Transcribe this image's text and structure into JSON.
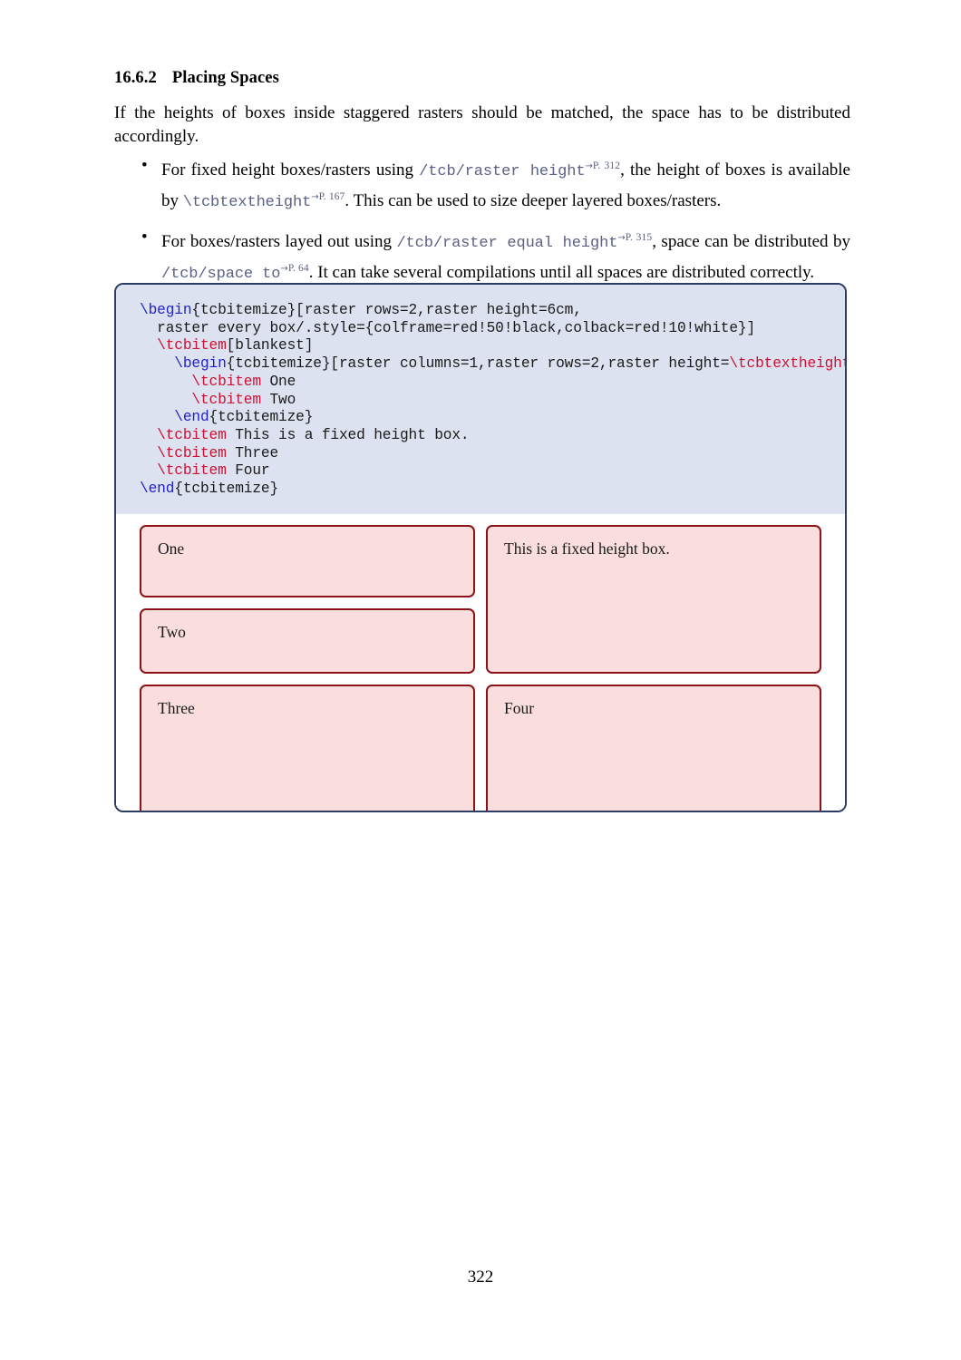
{
  "heading": {
    "number": "16.6.2",
    "title": "Placing Spaces"
  },
  "intro": {
    "text": "If the heights of boxes inside staggered rasters should be matched, the space has to be distributed accordingly."
  },
  "bullets": [
    {
      "marker": "•",
      "part1": "For fixed height boxes/rasters using ",
      "code1": "/tcb/raster height",
      "ref1_arrow": "→",
      "ref1": "P. 312",
      "part2": ", the height of boxes is available by ",
      "code2": "\\tcbtextheight",
      "ref2_arrow": "→",
      "ref2": "P. 167",
      "part3": ". This can be used to size deeper layered boxes/rasters."
    },
    {
      "marker": "•",
      "part1": "For boxes/rasters layed out using ",
      "code1": "/tcb/raster equal height",
      "ref1_arrow": "→",
      "ref1": "P. 315",
      "part2": ", space can be distributed by ",
      "code2": "/tcb/space to",
      "ref2_arrow": "→",
      "ref2": "P. 64",
      "part3": ". It can take several compilations until all spaces are distributed correctly."
    }
  ],
  "code": {
    "lines": [
      [
        {
          "t": "\\begin",
          "c": "blue"
        },
        {
          "t": "{tcbitemize}[raster rows=2,raster height=6cm,",
          "c": "plain"
        }
      ],
      [
        {
          "t": "  raster every box/.style={colframe=red!50!black,colback=red!10!white}]",
          "c": "plain"
        }
      ],
      [
        {
          "t": "  ",
          "c": "plain"
        },
        {
          "t": "\\tcbitem",
          "c": "red"
        },
        {
          "t": "[blankest]",
          "c": "plain"
        }
      ],
      [
        {
          "t": "    ",
          "c": "plain"
        },
        {
          "t": "\\begin",
          "c": "blue"
        },
        {
          "t": "{tcbitemize}[raster columns=1,raster rows=2,raster height=",
          "c": "plain"
        },
        {
          "t": "\\tcbtextheight",
          "c": "red"
        },
        {
          "t": "]",
          "c": "plain"
        }
      ],
      [
        {
          "t": "      ",
          "c": "plain"
        },
        {
          "t": "\\tcbitem",
          "c": "red"
        },
        {
          "t": " One",
          "c": "plain"
        }
      ],
      [
        {
          "t": "      ",
          "c": "plain"
        },
        {
          "t": "\\tcbitem",
          "c": "red"
        },
        {
          "t": " Two",
          "c": "plain"
        }
      ],
      [
        {
          "t": "    ",
          "c": "plain"
        },
        {
          "t": "\\end",
          "c": "blue"
        },
        {
          "t": "{tcbitemize}",
          "c": "plain"
        }
      ],
      [
        {
          "t": "  ",
          "c": "plain"
        },
        {
          "t": "\\tcbitem",
          "c": "red"
        },
        {
          "t": " This is a fixed height box.",
          "c": "plain"
        }
      ],
      [
        {
          "t": "  ",
          "c": "plain"
        },
        {
          "t": "\\tcbitem",
          "c": "red"
        },
        {
          "t": " Three",
          "c": "plain"
        }
      ],
      [
        {
          "t": "  ",
          "c": "plain"
        },
        {
          "t": "\\tcbitem",
          "c": "red"
        },
        {
          "t": " Four",
          "c": "plain"
        }
      ],
      [
        {
          "t": "\\end",
          "c": "blue"
        },
        {
          "t": "{tcbitemize}",
          "c": "plain"
        }
      ]
    ]
  },
  "result": {
    "box_one": "One",
    "box_two": "Two",
    "box_fixed": "This is a fixed height box.",
    "box_three": "Three",
    "box_four": "Four"
  },
  "footer": {
    "page_number": "322"
  },
  "colors": {
    "frame_border": "#2c3c62",
    "code_background": "#dde2f0",
    "box_border": "#8b1217",
    "box_background": "#fadddd",
    "link": "#5a6185",
    "token_blue": "#2222cc",
    "token_red": "#cc1133"
  }
}
